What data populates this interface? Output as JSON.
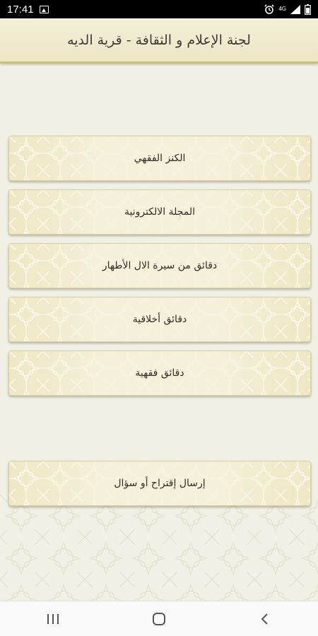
{
  "status_bar": {
    "time": "17:41",
    "icons": [
      "gallery-icon",
      "alarm-icon",
      "lte-icon",
      "signal-icon",
      "battery-icon"
    ],
    "network_label": "4G"
  },
  "header": {
    "title": "لجنة الإعلام و الثقافة - قرية الديه"
  },
  "menu": {
    "items": [
      {
        "label": "الكنز الفقهي"
      },
      {
        "label": "المجلة الالكترونية"
      },
      {
        "label": "دقائق من سيرة الال الأطهار"
      },
      {
        "label": "دقائق أخلاقية"
      },
      {
        "label": "دقائق فقهية"
      }
    ],
    "suggestion_label": "إرسال إقتراح أو سؤال"
  },
  "nav_bar": {
    "icons": [
      "recent-apps-icon",
      "home-icon",
      "back-icon"
    ]
  },
  "colors": {
    "header_bg": "#ece6c4",
    "header_border": "#c9bd87",
    "button_bg": "#f3efd6",
    "pattern_stroke": "#ffffff",
    "text": "#2e2d28"
  }
}
